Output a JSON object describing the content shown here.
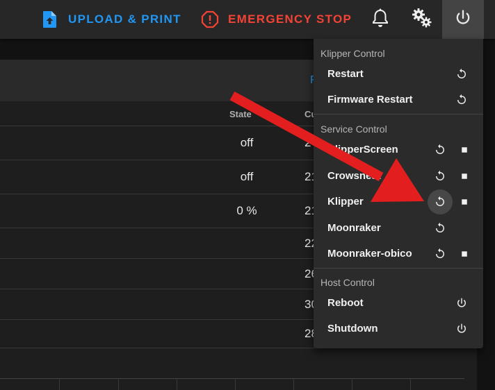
{
  "topbar": {
    "upload_label": "UPLOAD & PRINT",
    "emergency_label": "EMERGENCY STOP",
    "icons": [
      "file-upload-icon",
      "alert-octagon-icon",
      "bell-icon",
      "cog-icon",
      "power-icon"
    ]
  },
  "colors": {
    "accent_blue": "#2196f3",
    "emergency_red": "#f44336",
    "annotation_arrow": "#e31e1e"
  },
  "table": {
    "headers": {
      "state": "State",
      "current": "Cu"
    },
    "rows": [
      {
        "state": "off",
        "current": "2"
      },
      {
        "state": "off",
        "current": "21"
      },
      {
        "state": "0 %",
        "current": "21"
      },
      {
        "state": "",
        "current": "22"
      },
      {
        "state": "",
        "current": "26"
      },
      {
        "state": "",
        "current": "30"
      },
      {
        "state": "",
        "current": "28"
      }
    ],
    "header_link": "F"
  },
  "menu": {
    "klipper_control": {
      "title": "Klipper Control",
      "items": [
        {
          "label": "Restart"
        },
        {
          "label": "Firmware Restart"
        }
      ]
    },
    "service_control": {
      "title": "Service Control",
      "items": [
        {
          "label": "KlipperScreen"
        },
        {
          "label": "Crowsnest"
        },
        {
          "label": "Klipper"
        },
        {
          "label": "Moonraker"
        },
        {
          "label": "Moonraker-obico"
        }
      ]
    },
    "host_control": {
      "title": "Host Control",
      "items": [
        {
          "label": "Reboot"
        },
        {
          "label": "Shutdown"
        }
      ]
    }
  }
}
